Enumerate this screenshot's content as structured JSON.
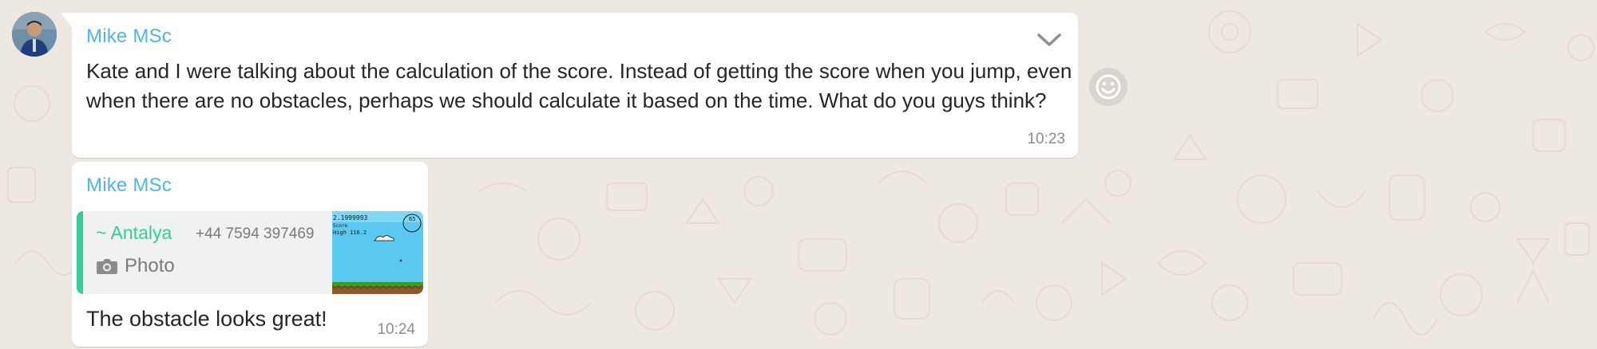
{
  "messages": [
    {
      "sender": "Mike MSc",
      "text": "Kate and I were talking about the calculation of the score. Instead of getting the score when you jump, even when there are no obstacles, perhaps we should calculate it based on the time. What do you guys think?",
      "time": "10:23",
      "menu_icon": "chevron-down-icon"
    },
    {
      "sender": "Mike MSc",
      "quoted": {
        "author": "~ Antalya",
        "phone": "+44 7594 397469",
        "type_label": "Photo",
        "type_icon": "camera-icon",
        "thumbnail_text": [
          "2.1999993",
          "Score",
          "High 116.2",
          "65"
        ]
      },
      "text": "The obstacle looks great!",
      "time": "10:24"
    }
  ],
  "reaction_icon": "smiley-icon",
  "colors": {
    "sender_name": "#4fb6e6",
    "quote_accent": "#35cd96",
    "bubble_bg": "#ffffff",
    "chat_bg": "#ede8e1"
  }
}
